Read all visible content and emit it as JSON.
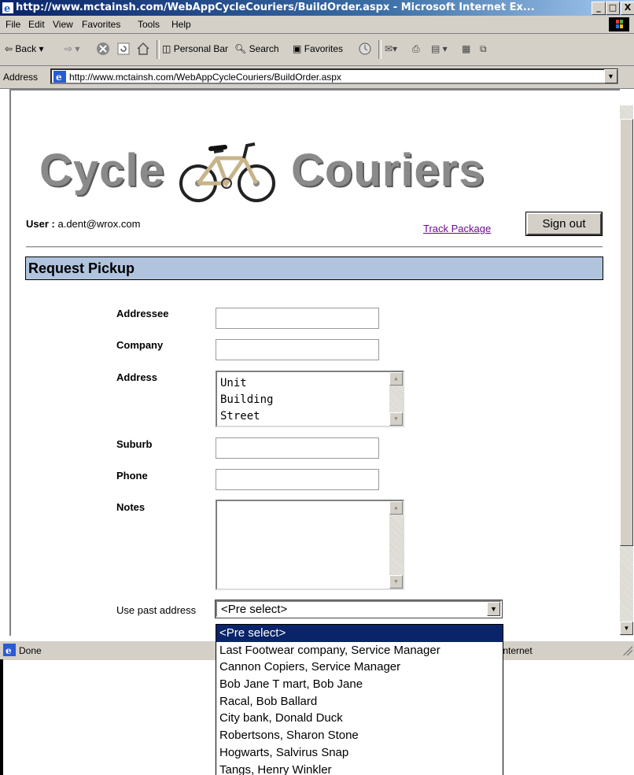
{
  "window": {
    "title": "http://www.mctainsh.com/WebAppCycleCouriers/BuildOrder.aspx - Microsoft Internet Ex...",
    "minimize": "_",
    "maximize": "□",
    "close": "X"
  },
  "menu": [
    "File",
    "Edit",
    "View",
    "Favorites",
    "Tools",
    "Help"
  ],
  "toolbar": {
    "back": "Back",
    "personal_bar": "Personal Bar",
    "search": "Search",
    "favorites": "Favorites"
  },
  "address": {
    "label": "Address",
    "url": "http://www.mctainsh.com/WebAppCycleCouriers/BuildOrder.aspx"
  },
  "page": {
    "logo_left": "Cycle",
    "logo_right": "Couriers",
    "user_label": "User :",
    "user_value": "a.dent@wrox.com",
    "track_link": "Track Package",
    "signout": "Sign out",
    "section_title": "Request Pickup",
    "fields": {
      "addressee": "Addressee",
      "company": "Company",
      "address": "Address",
      "suburb": "Suburb",
      "phone": "Phone",
      "notes": "Notes"
    },
    "address_value": "Unit\nBuilding\nStreet",
    "past_address_label": "Use past address",
    "past_address_selected": "<Pre select>",
    "past_address_options": [
      "<Pre select>",
      "Last Footwear company, Service Manager",
      "Cannon Copiers, Service Manager",
      "Bob Jane T mart, Bob Jane",
      "Racal, Bob Ballard",
      "City bank, Donald Duck",
      "Robertsons, Sharon Stone",
      "Hogwarts, Salvirus Snap",
      "Tangs, Henry Winkler"
    ]
  },
  "status": {
    "text": "Done",
    "zone": "Internet"
  }
}
